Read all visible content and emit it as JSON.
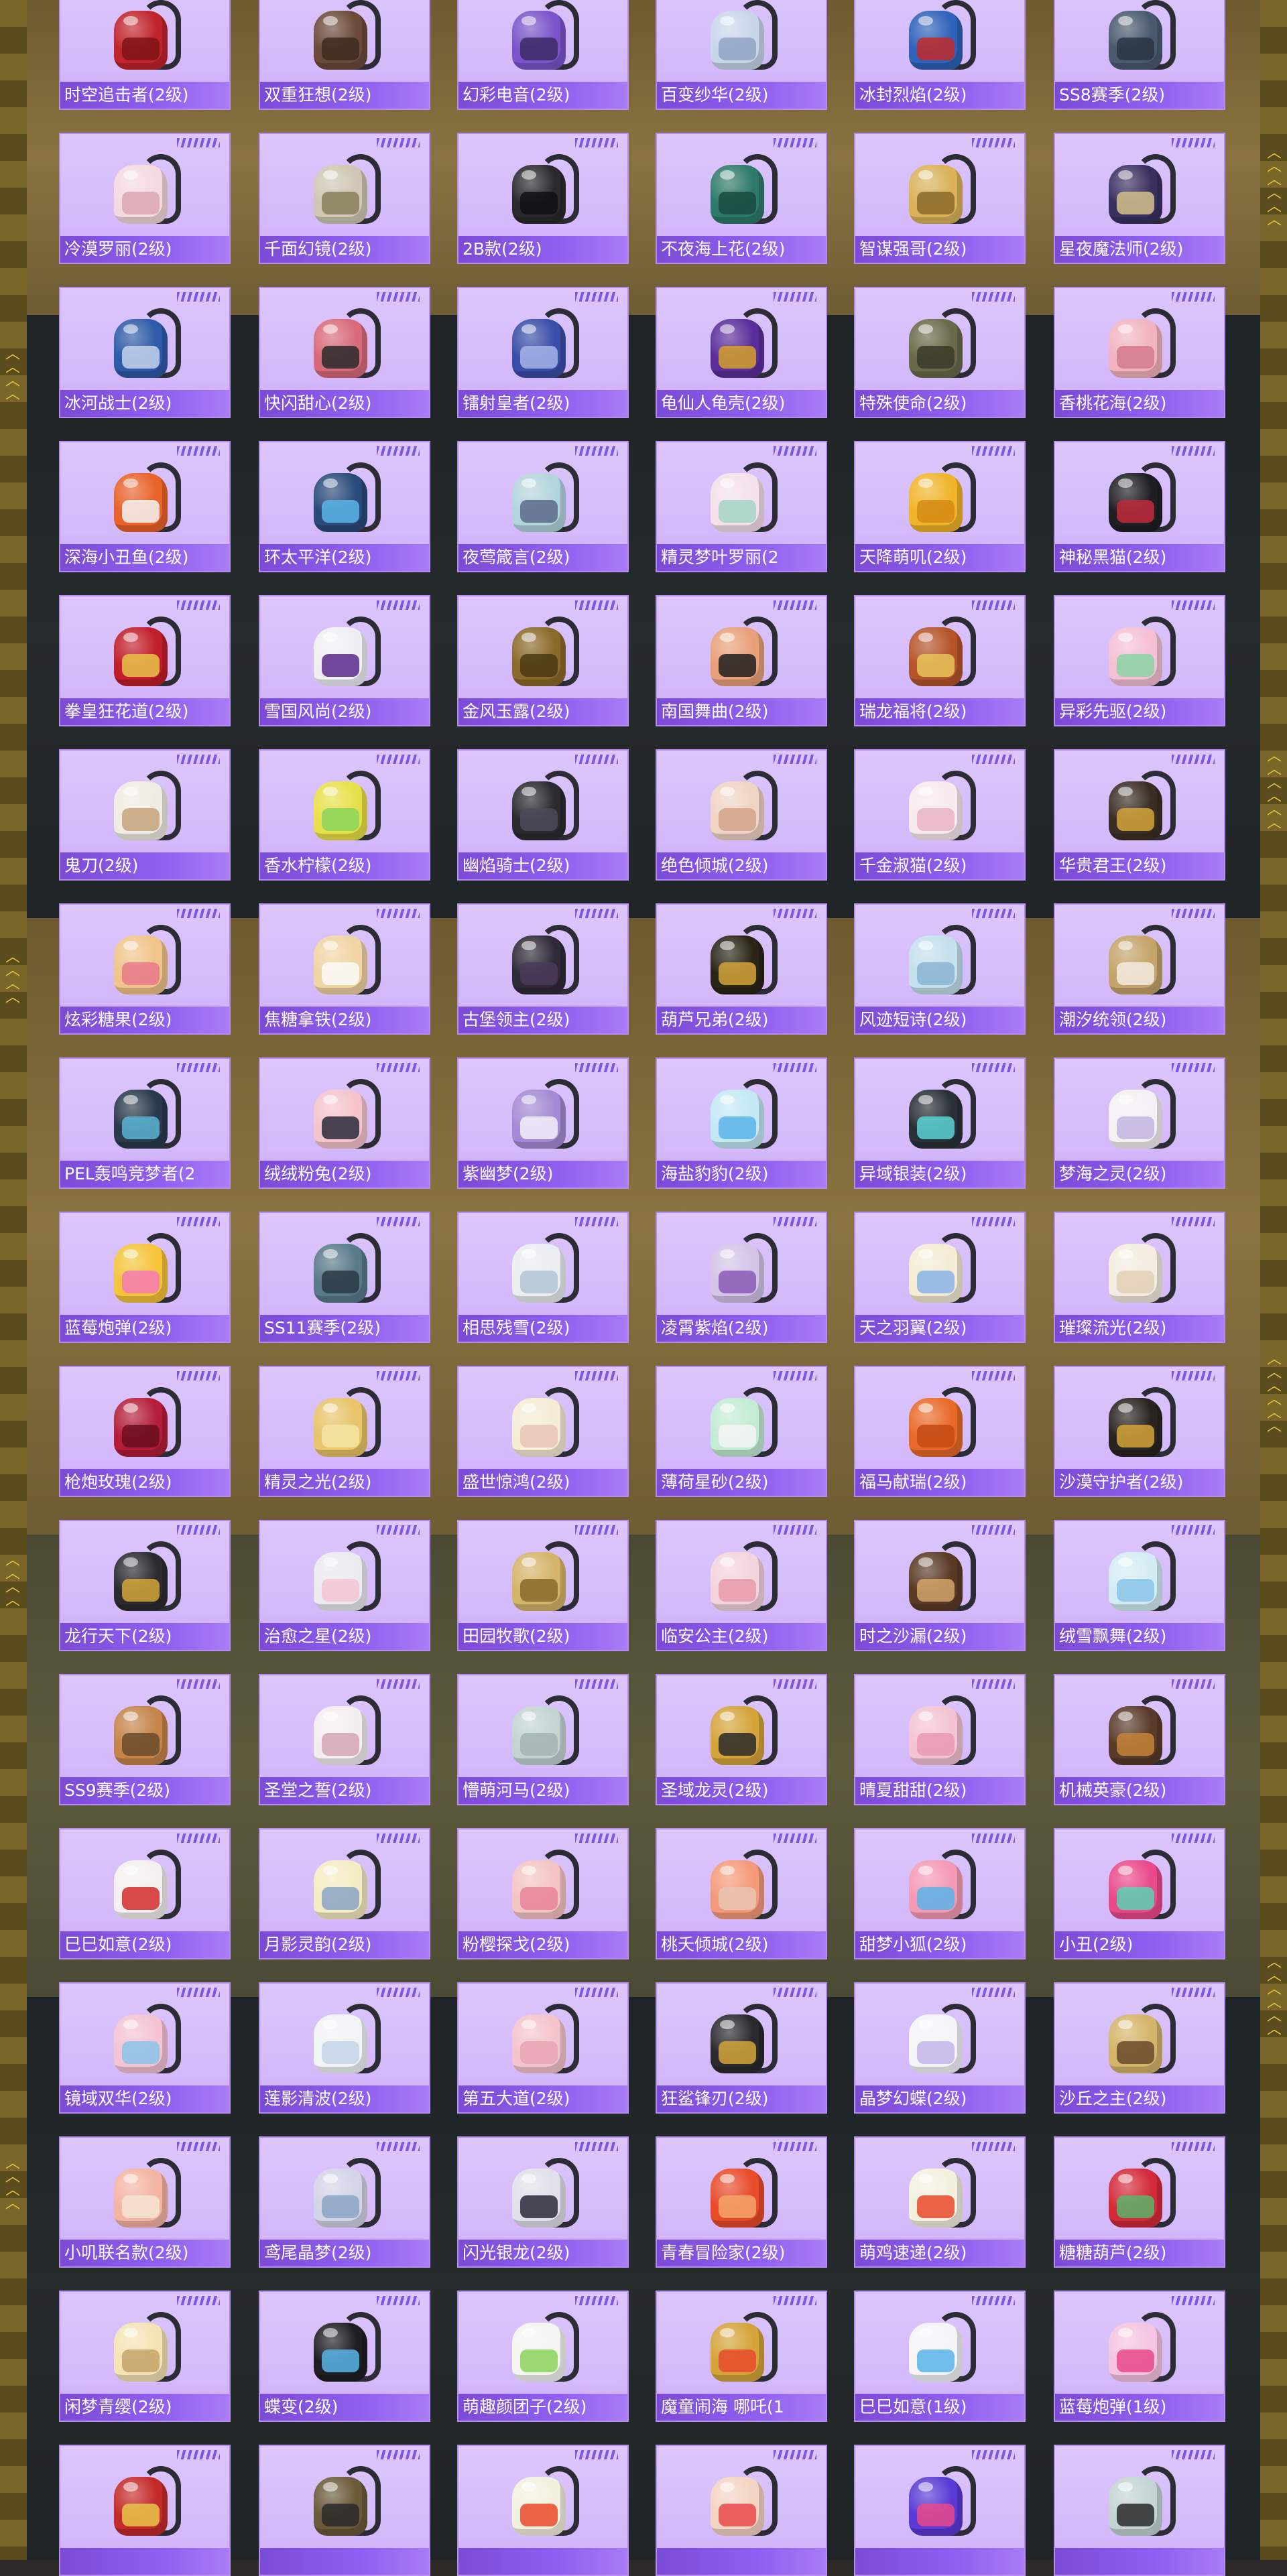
{
  "cards": [
    {
      "label": "时空追击者(2级)",
      "color": "#c0242c",
      "pocket": "#7e1418"
    },
    {
      "label": "双重狂想(2级)",
      "color": "#6b4a3a",
      "pocket": "#3d2a20"
    },
    {
      "label": "幻彩电音(2级)",
      "color": "#7a54c8",
      "pocket": "#3a2a66"
    },
    {
      "label": "百变纱华(2级)",
      "color": "#c9d6ea",
      "pocket": "#8fa4c4"
    },
    {
      "label": "冰封烈焰(2级)",
      "color": "#2f62b8",
      "pocket": "#c02a2a"
    },
    {
      "label": "SS8赛季(2级)",
      "color": "#4a5a6e",
      "pocket": "#2a3442"
    },
    {
      "label": "冷漠罗丽(2级)",
      "color": "#f4dadf",
      "pocket": "#d9a7b2"
    },
    {
      "label": "千面幻镜(2级)",
      "color": "#cfc7b4",
      "pocket": "#8a7e5a"
    },
    {
      "label": "2B款(2级)",
      "color": "#2a2a2e",
      "pocket": "#111114"
    },
    {
      "label": "不夜海上花(2级)",
      "color": "#2e7a6a",
      "pocket": "#174a40"
    },
    {
      "label": "智谋强哥(2级)",
      "color": "#d9b25a",
      "pocket": "#8a6a2a"
    },
    {
      "label": "星夜魔法师(2级)",
      "color": "#3a3060",
      "pocket": "#d4c18a"
    },
    {
      "label": "冰河战士(2级)",
      "color": "#2e5aa8",
      "pocket": "#c4d4ec"
    },
    {
      "label": "快闪甜心(2级)",
      "color": "#d86a7a",
      "pocket": "#2a2a2a"
    },
    {
      "label": "镭射皇者(2级)",
      "color": "#3a4ea8",
      "pocket": "#a4b4e8"
    },
    {
      "label": "龟仙人龟壳(2级)",
      "color": "#5a2e9a",
      "pocket": "#d4a02a"
    },
    {
      "label": "特殊使命(2级)",
      "color": "#6a6a4a",
      "pocket": "#3a3a2a"
    },
    {
      "label": "香桃花海(2级)",
      "color": "#f2b4c0",
      "pocket": "#d47a8e"
    },
    {
      "label": "深海小丑鱼(2级)",
      "color": "#e8622a",
      "pocket": "#f4f4f4"
    },
    {
      "label": "环太平洋(2级)",
      "color": "#2a4a7a",
      "pocket": "#5ab4e8"
    },
    {
      "label": "夜莺箴言(2级)",
      "color": "#b4d4dc",
      "pocket": "#5a6a8a"
    },
    {
      "label": "精灵梦叶罗丽(2",
      "color": "#f4e0ea",
      "pocket": "#a4d4c4"
    },
    {
      "label": "天降萌叽(2级)",
      "color": "#f0b42a",
      "pocket": "#d48a14"
    },
    {
      "label": "神秘黑猫(2级)",
      "color": "#1e1e24",
      "pocket": "#c02a3a"
    },
    {
      "label": "拳皇狂花道(2级)",
      "color": "#c01e2a",
      "pocket": "#e8c44a"
    },
    {
      "label": "雪国风尚(2级)",
      "color": "#f0f0f4",
      "pocket": "#5a2a8a"
    },
    {
      "label": "金风玉露(2级)",
      "color": "#8a6a2a",
      "pocket": "#4a3a14"
    },
    {
      "label": "南国舞曲(2级)",
      "color": "#e8a07a",
      "pocket": "#1e1e1e"
    },
    {
      "label": "瑞龙福将(2级)",
      "color": "#b4542a",
      "pocket": "#e8c45a"
    },
    {
      "label": "异彩先驱(2级)",
      "color": "#f4c0d4",
      "pocket": "#8ad4a4"
    },
    {
      "label": "鬼刀(2级)",
      "color": "#f0ece4",
      "pocket": "#c4a47a"
    },
    {
      "label": "香水柠檬(2级)",
      "color": "#e8e04a",
      "pocket": "#8ad45a"
    },
    {
      "label": "幽焰骑士(2级)",
      "color": "#2a2a30",
      "pocket": "#4a4a5a"
    },
    {
      "label": "绝色倾城(2级)",
      "color": "#f0d4c4",
      "pocket": "#d4a48a"
    },
    {
      "label": "千金淑猫(2级)",
      "color": "#f8eaf0",
      "pocket": "#e8b4c4"
    },
    {
      "label": "华贵君王(2级)",
      "color": "#3a2e24",
      "pocket": "#d4a43a"
    },
    {
      "label": "炫彩糖果(2级)",
      "color": "#f0c48a",
      "pocket": "#e87a8a"
    },
    {
      "label": "焦糖拿铁(2级)",
      "color": "#f0d4a4",
      "pocket": "#fafafa"
    },
    {
      "label": "古堡领主(2级)",
      "color": "#2e2a38",
      "pocket": "#4a3a5a"
    },
    {
      "label": "葫芦兄弟(2级)",
      "color": "#2a2416",
      "pocket": "#d4a43a"
    },
    {
      "label": "风迹短诗(2级)",
      "color": "#c4e0ec",
      "pocket": "#8ab4d4"
    },
    {
      "label": "潮汐统领(2级)",
      "color": "#c4a46a",
      "pocket": "#f4ece0"
    },
    {
      "label": "PEL轰鸣竞梦者(2",
      "color": "#2a3a4a",
      "pocket": "#5ab4d4"
    },
    {
      "label": "绒绒粉兔(2级)",
      "color": "#f4c4cc",
      "pocket": "#2a2a3a"
    },
    {
      "label": "紫幽梦(2级)",
      "color": "#a48ad4",
      "pocket": "#f4f0fa"
    },
    {
      "label": "海盐豹豹(2级)",
      "color": "#c4e8f4",
      "pocket": "#5ab4e8"
    },
    {
      "label": "异域银装(2级)",
      "color": "#2a3038",
      "pocket": "#5ad4d4"
    },
    {
      "label": "梦海之灵(2级)",
      "color": "#f4f0f4",
      "pocket": "#c4b4e0"
    },
    {
      "label": "蓝莓炮弹(2级)",
      "color": "#f4c43a",
      "pocket": "#f47ab4"
    },
    {
      "label": "SS11赛季(2级)",
      "color": "#5a7a8a",
      "pocket": "#2a3a44"
    },
    {
      "label": "相思残雪(2级)",
      "color": "#eaeef2",
      "pocket": "#b4c4d4"
    },
    {
      "label": "凌霄紫焰(2级)",
      "color": "#d4c4e8",
      "pocket": "#8a5ab4"
    },
    {
      "label": "天之羽翼(2级)",
      "color": "#f4ecd4",
      "pocket": "#8ab4e8"
    },
    {
      "label": "璀璨流光(2级)",
      "color": "#f4ece0",
      "pocket": "#e0d0b4"
    },
    {
      "label": "枪炮玫瑰(2级)",
      "color": "#b41e3a",
      "pocket": "#6a0e1e"
    },
    {
      "label": "精灵之光(2级)",
      "color": "#e8c46a",
      "pocket": "#f4e4a4"
    },
    {
      "label": "盛世惊鸿(2级)",
      "color": "#f4ecd4",
      "pocket": "#e8c4b4"
    },
    {
      "label": "薄荷星砂(2级)",
      "color": "#c4ecd4",
      "pocket": "#f4f4f4"
    },
    {
      "label": "福马献瑞(2级)",
      "color": "#e86a2a",
      "pocket": "#c44a14"
    },
    {
      "label": "沙漠守护者(2级)",
      "color": "#2a2420",
      "pocket": "#d4a43a"
    },
    {
      "label": "龙行天下(2级)",
      "color": "#2a2a30",
      "pocket": "#d4a43a"
    },
    {
      "label": "治愈之星(2级)",
      "color": "#eaeaf0",
      "pocket": "#f4c4d4"
    },
    {
      "label": "田园牧歌(2级)",
      "color": "#d4b46a",
      "pocket": "#8a6a2a"
    },
    {
      "label": "临安公主(2级)",
      "color": "#f4d4dc",
      "pocket": "#e89aaa"
    },
    {
      "label": "时之沙漏(2级)",
      "color": "#5a3a24",
      "pocket": "#d4a46a"
    },
    {
      "label": "绒雪飘舞(2级)",
      "color": "#d4ecf4",
      "pocket": "#8ac4e8"
    },
    {
      "label": "SS9赛季(2级)",
      "color": "#c4844a",
      "pocket": "#6a4a2a"
    },
    {
      "label": "圣堂之誓(2级)",
      "color": "#f4eef0",
      "pocket": "#d4a4b4"
    },
    {
      "label": "懵萌河马(2级)",
      "color": "#c4d4d4",
      "pocket": "#a4b4b4"
    },
    {
      "label": "圣域龙灵(2级)",
      "color": "#d4a43a",
      "pocket": "#2a2a2a"
    },
    {
      "label": "晴夏甜甜(2级)",
      "color": "#f4c4d4",
      "pocket": "#e89ab4"
    },
    {
      "label": "机械英豪(2级)",
      "color": "#5a3a2a",
      "pocket": "#c4843a"
    },
    {
      "label": "巳巳如意(2级)",
      "color": "#f4f0f0",
      "pocket": "#d42a2a"
    },
    {
      "label": "月影灵韵(2级)",
      "color": "#f4ecc4",
      "pocket": "#8aa4c4"
    },
    {
      "label": "粉樱探戈(2级)",
      "color": "#f4c4c4",
      "pocket": "#e8849a"
    },
    {
      "label": "桃夭倾城(2级)",
      "color": "#f49a7a",
      "pocket": "#e8c4b4"
    },
    {
      "label": "甜梦小狐(2级)",
      "color": "#f49ab4",
      "pocket": "#5ab4e8"
    },
    {
      "label": "小丑(2级)",
      "color": "#e84a8a",
      "pocket": "#5ad4b4"
    },
    {
      "label": "镜域双华(2级)",
      "color": "#f4c4d4",
      "pocket": "#8ac4e8"
    },
    {
      "label": "莲影清波(2级)",
      "color": "#f0f4f4",
      "pocket": "#c4d4e8"
    },
    {
      "label": "第五大道(2级)",
      "color": "#f4c4cc",
      "pocket": "#e8a4b4"
    },
    {
      "label": "狂鲨锋刃(2级)",
      "color": "#2a2a2e",
      "pocket": "#d4a43a"
    },
    {
      "label": "晶梦幻蝶(2级)",
      "color": "#f4f4fa",
      "pocket": "#c4b4e8"
    },
    {
      "label": "沙丘之主(2级)",
      "color": "#d4b46a",
      "pocket": "#6a4a2a"
    },
    {
      "label": "小叽联名款(2级)",
      "color": "#f4b4a4",
      "pocket": "#f4e4d4"
    },
    {
      "label": "鸢尾晶梦(2级)",
      "color": "#d4d4e8",
      "pocket": "#8aa4c4"
    },
    {
      "label": "闪光银龙(2级)",
      "color": "#e0e0ea",
      "pocket": "#2a2a3a"
    },
    {
      "label": "青春冒险家(2级)",
      "color": "#e84a2a",
      "pocket": "#f4a46a"
    },
    {
      "label": "萌鸡速递(2级)",
      "color": "#f4f0e0",
      "pocket": "#e84a2a"
    },
    {
      "label": "糖糖葫芦(2级)",
      "color": "#d42a3a",
      "pocket": "#5ab46a"
    },
    {
      "label": "闲梦青缨(2级)",
      "color": "#f4e4b4",
      "pocket": "#c4a46a"
    },
    {
      "label": "蝶变(2级)",
      "color": "#1e1e24",
      "pocket": "#5ab4e8"
    },
    {
      "label": "萌趣颜团子(2级)",
      "color": "#f4f4f0",
      "pocket": "#8ad45a"
    },
    {
      "label": "魔童闹海 哪吒(1",
      "color": "#d4a43a",
      "pocket": "#e84a2a"
    },
    {
      "label": "巳巳如意(1级)",
      "color": "#f4f4fa",
      "pocket": "#5ab4e8"
    },
    {
      "label": "蓝莓炮弹(1级)",
      "color": "#f4c4e0",
      "pocket": "#e84a8a"
    },
    {
      "label": "",
      "color": "#c42a2a",
      "pocket": "#e8c44a"
    },
    {
      "label": "",
      "color": "#6a5a3a",
      "pocket": "#2a2a2a"
    },
    {
      "label": "",
      "color": "#f4f0e0",
      "pocket": "#e84a2a"
    },
    {
      "label": "",
      "color": "#f4d4c4",
      "pocket": "#e84a4a"
    },
    {
      "label": "",
      "color": "#5a3ad4",
      "pocket": "#e84a8a"
    },
    {
      "label": "",
      "color": "#c4d4d4",
      "pocket": "#2a2a2a"
    }
  ]
}
